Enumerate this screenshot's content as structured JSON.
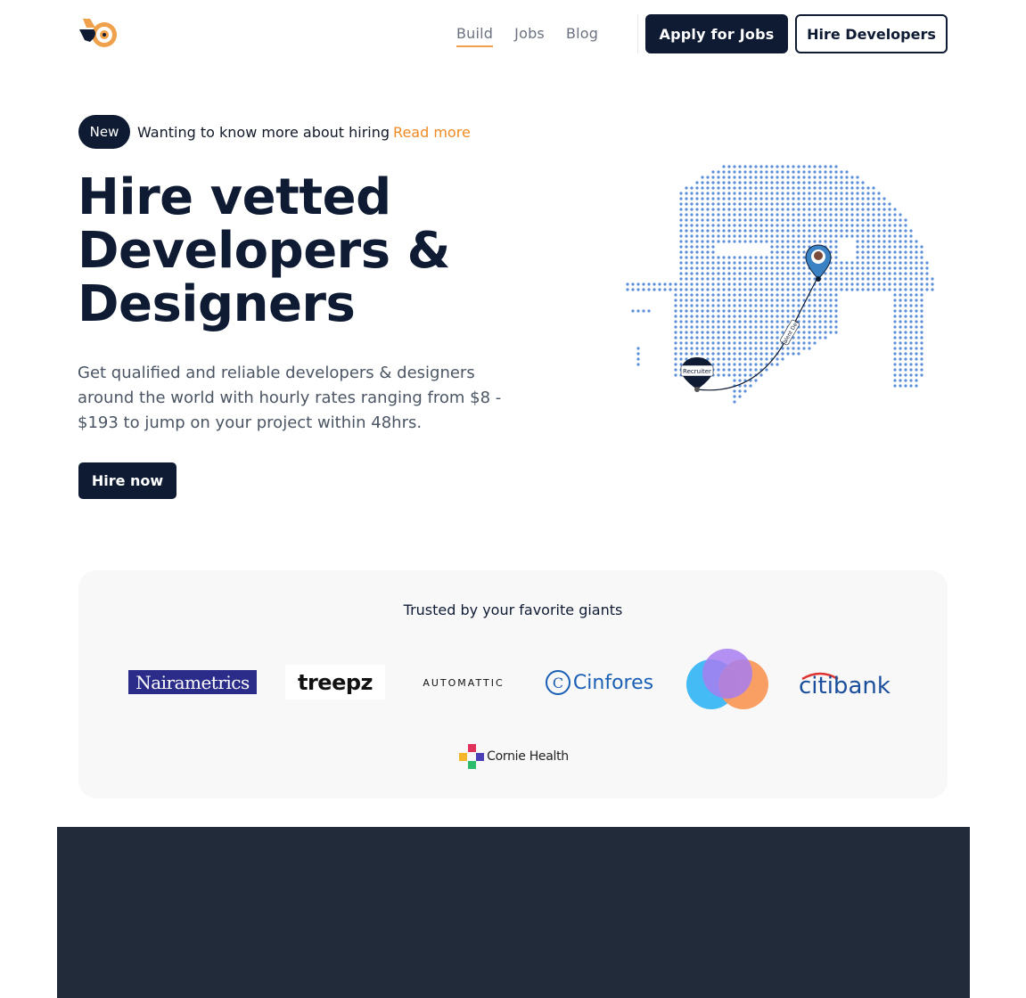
{
  "header": {
    "logo": "brand-logo",
    "nav": [
      {
        "label": "Build",
        "active": true
      },
      {
        "label": "Jobs",
        "active": false
      },
      {
        "label": "Blog",
        "active": false
      }
    ],
    "apply_label": "Apply for Jobs",
    "hire_label": "Hire Developers"
  },
  "announcement": {
    "badge": "New",
    "text": "Wanting to know more about hiring",
    "link": "Read more"
  },
  "hero": {
    "title": "Hire vetted Developers & Designers",
    "subtitle": "Get qualified and reliable developers & designers around the world with hourly rates ranging from $8 - $193 to jump on your project within 48hrs.",
    "cta": "Hire now"
  },
  "map": {
    "pin_label": "Recruiter",
    "route_label": "Talent Dev"
  },
  "trusted": {
    "title": "Trusted by your favorite giants",
    "logos": [
      {
        "name": "Nairametrics"
      },
      {
        "name": "treepz"
      },
      {
        "name": "AUTOMATTIC"
      },
      {
        "name": "Cinfores"
      },
      {
        "name": "overlapping-circles-logo"
      },
      {
        "name": "citibank"
      },
      {
        "name": "Cornie Health"
      }
    ]
  },
  "colors": {
    "primary": "#0f1b33",
    "accent": "#f08a24",
    "dark_section": "#212b3a",
    "map_dots": "#5b8fd9"
  }
}
